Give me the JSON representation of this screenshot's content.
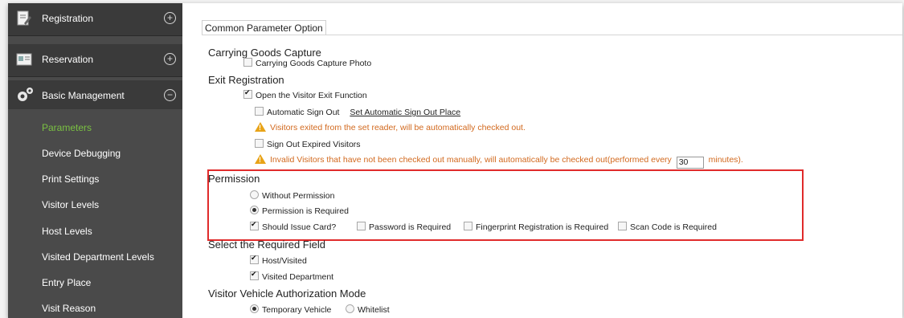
{
  "sidebar": {
    "menus": [
      {
        "label": "Registration",
        "icon": "registration-icon",
        "toggle": "+"
      },
      {
        "label": "Reservation",
        "icon": "reservation-icon",
        "toggle": "+"
      },
      {
        "label": "Basic Management",
        "icon": "gears-icon",
        "toggle": "−"
      }
    ],
    "items": [
      {
        "label": "Parameters",
        "active": true
      },
      {
        "label": "Device Debugging"
      },
      {
        "label": "Print Settings"
      },
      {
        "label": "Visitor Levels"
      },
      {
        "label": "Host Levels"
      },
      {
        "label": "Visited Department Levels"
      },
      {
        "label": "Entry Place"
      },
      {
        "label": "Visit Reason"
      }
    ]
  },
  "content": {
    "tab_title": "Common Parameter Option",
    "carrying": {
      "heading": "Carrying Goods Capture",
      "capture_photo": "Carrying Goods Capture Photo"
    },
    "exit": {
      "heading": "Exit Registration",
      "open_exit": "Open the Visitor Exit Function",
      "auto_sign_out": "Automatic Sign Out",
      "set_place_link": "Set Automatic Sign Out Place",
      "warn1": "Visitors exited from the set reader, will be automatically checked out.",
      "sign_out_expired": "Sign Out Expired Visitors",
      "warn2_pre": "Invalid Visitors that have not been checked out manually, will automatically be checked out(performed every",
      "interval_value": "30",
      "warn2_post": "minutes)."
    },
    "permission": {
      "heading": "Permission",
      "without": "Without Permission",
      "required": "Permission is Required",
      "issue_card": "Should Issue Card?",
      "password": "Password is Required",
      "fingerprint": "Fingerprint Registration is Required",
      "scan_code": "Scan Code is Required"
    },
    "required_field": {
      "heading": "Select the Required Field",
      "host": "Host/Visited",
      "dept": "Visited Department"
    },
    "vehicle": {
      "heading": "Visitor Vehicle Authorization Mode",
      "temporary": "Temporary Vehicle",
      "whitelist": "Whitelist"
    }
  },
  "colors": {
    "sidebar_bg": "#4a4a4a",
    "active_item": "#7ac142",
    "warning_text": "#d2691e",
    "highlight_box": "#e02b2b"
  }
}
